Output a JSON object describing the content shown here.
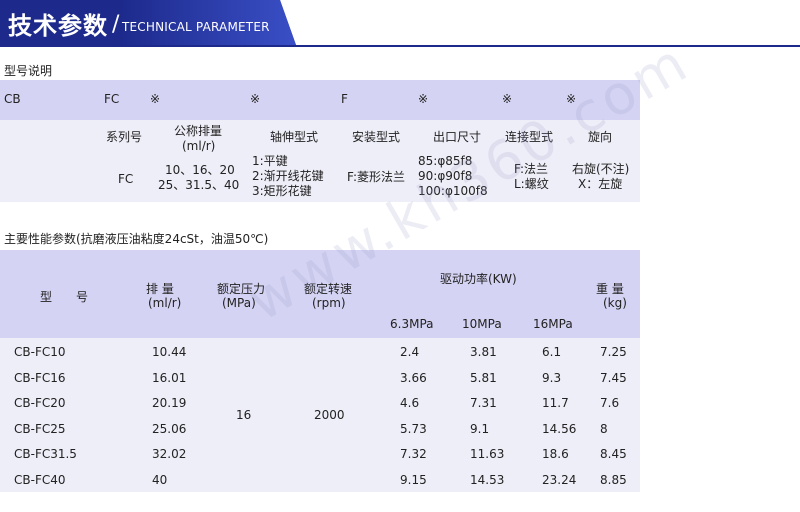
{
  "banner": {
    "title": "技术参数",
    "slash": "/",
    "subtitle": "TECHNICAL PARAMETER"
  },
  "model": {
    "section_title": "型号说明",
    "code_bar": [
      "CB",
      "FC",
      "※",
      "※",
      "F",
      "※",
      "※",
      "※"
    ],
    "headers": [
      "系列号",
      "公称排量",
      "(ml/r)",
      "轴伸型式",
      "安装型式",
      "出口尺寸",
      "连接型式",
      "旋向"
    ],
    "series": "FC",
    "displacement_line1": "10、16、20",
    "displacement_line2": "25、31.5、40",
    "shaft": [
      "1:平键",
      "2:渐开线花键",
      "3:矩形花键"
    ],
    "mount": "F:菱形法兰",
    "outlet": [
      "85:φ85f8",
      "90:φ90f8",
      "100:φ100f8"
    ],
    "connection": [
      "F:法兰",
      "L:螺纹"
    ],
    "rotation": [
      "右旋(不注)",
      "X：左旋"
    ]
  },
  "perf": {
    "section_title": "主要性能参数(抗磨液压油粘度24cSt，油温50℃)",
    "headers": {
      "model": "型　　号",
      "disp": "排  量",
      "disp_unit": "(ml/r)",
      "pressure": "额定压力",
      "pressure_unit": "(MPa)",
      "speed": "额定转速",
      "speed_unit": "(rpm)",
      "power": "驱动功率(KW)",
      "p1": "6.3MPa",
      "p2": "10MPa",
      "p3": "16MPa",
      "weight": "重 量",
      "weight_unit": "(kg)"
    },
    "rated_pressure": "16",
    "rated_speed": "2000",
    "rows": [
      {
        "model": "CB-FC10",
        "disp": "10.44",
        "p1": "2.4",
        "p2": "3.81",
        "p3": "6.1",
        "weight": "7.25"
      },
      {
        "model": "CB-FC16",
        "disp": "16.01",
        "p1": "3.66",
        "p2": "5.81",
        "p3": "9.3",
        "weight": "7.45"
      },
      {
        "model": "CB-FC20",
        "disp": "20.19",
        "p1": "4.6",
        "p2": "7.31",
        "p3": "11.7",
        "weight": "7.6"
      },
      {
        "model": "CB-FC25",
        "disp": "25.06",
        "p1": "5.73",
        "p2": "9.1",
        "p3": "14.56",
        "weight": "8"
      },
      {
        "model": "CB-FC31.5",
        "disp": "32.02",
        "p1": "7.32",
        "p2": "11.63",
        "p3": "18.6",
        "weight": "8.45"
      },
      {
        "model": "CB-FC40",
        "disp": "40",
        "p1": "9.15",
        "p2": "14.53",
        "p3": "23.24",
        "weight": "8.85"
      }
    ]
  },
  "watermark": "www.kh360.com"
}
